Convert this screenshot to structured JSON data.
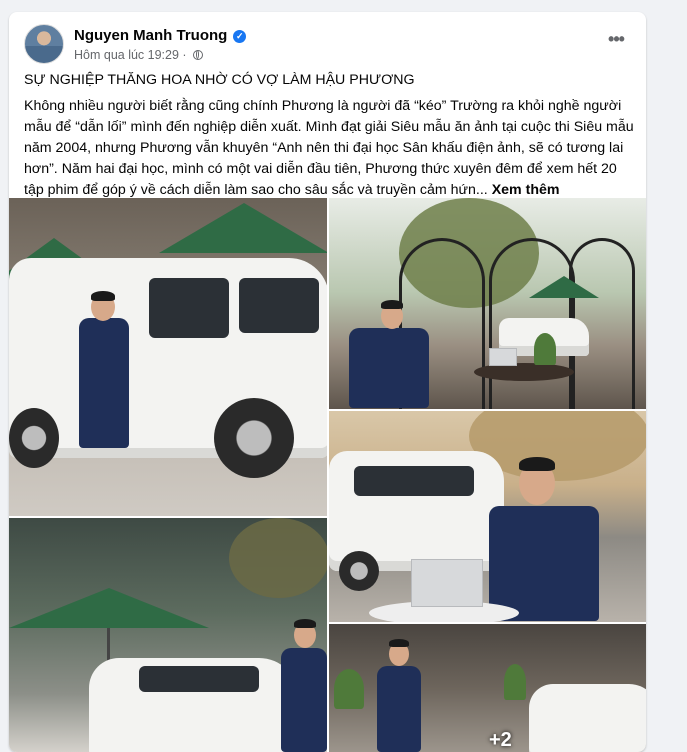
{
  "post": {
    "author": "Nguyen Manh Truong",
    "timestamp": "Hôm qua lúc 19:29",
    "title": "SỰ NGHIỆP THĂNG HOA NHỜ CÓ VỢ LÀM HẬU PHƯƠNG",
    "body": "Không nhiều người biết rằng cũng chính Phương là người đã “kéo” Trường ra khỏi nghề người mẫu để “dẫn lối” mình đến nghiệp diễn xuất. Mình đạt giải Siêu mẫu ăn ảnh tại cuộc thi Siêu mẫu năm 2004, nhưng Phương vẫn khuyên “Anh nên thi đại học Sân khấu điện ảnh, sẽ có tương lai hơn”. Năm hai đại học, mình có một vai diễn đầu tiên, Phương thức xuyên đêm để xem hết 20 tập phim để góp ý về cách diễn làm sao cho sâu sắc và truyền cảm hứn...",
    "see_more": "Xem thêm",
    "more_options": "•••",
    "verified_mark": "✓"
  },
  "photos": {
    "overlay_count": "+2"
  },
  "icons": {
    "avatar": "avatar",
    "verified": "verified-badge-icon",
    "audience": "globe-icon",
    "more": "more-options-icon"
  },
  "colors": {
    "accent": "#1877f2",
    "secondary_text": "#65676b",
    "background": "#f0f2f5"
  }
}
